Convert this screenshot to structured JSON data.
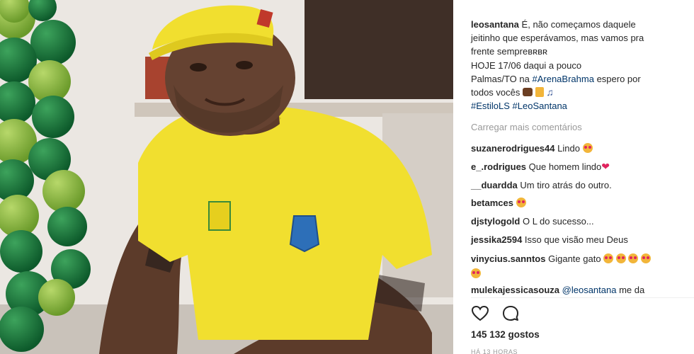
{
  "post": {
    "author": "leosantana",
    "caption_lines": [
      "É, não começamos daquele",
      "jeitinho que esperávamos, mas vamos pra",
      "frente sempreʙʀʙʀ",
      "HOJE 17/06 daqui a pouco"
    ],
    "caption_palmas": "Palmas/TO na",
    "caption_hashtag_arena": "#ArenaBrahma",
    "caption_espero": "espero por",
    "caption_todos": "todos vocês",
    "hashtag_estilo": "#EstiloLS",
    "hashtag_leo": "#LeoSantana",
    "load_more": "Carregar mais comentários",
    "likes": "145 132 gostos",
    "time": "HÁ 13 HORAS"
  },
  "comments": [
    {
      "user": "suzanerodrigues44",
      "text": "Lindo"
    },
    {
      "user": "e_.rodrigues",
      "text": "Que homem lindo"
    },
    {
      "user": "__duardda",
      "text": "Um tiro atrás do outro."
    },
    {
      "user": "betamces",
      "text": ""
    },
    {
      "user": "djstylogold",
      "text": "O L do sucesso..."
    },
    {
      "user": "jessika2594",
      "text": "Isso que visão meu Deus"
    },
    {
      "user": "vinycius.sanntos",
      "text": "Gigante gato"
    },
    {
      "user": "mulekajessicasouza",
      "text": "me da",
      "mention": "@leosantana"
    }
  ],
  "icons": {
    "like": "heart-outline-icon",
    "comment": "comment-bubble-icon"
  },
  "colors": {
    "shirt": "#f1df2f",
    "balloon_dark": "#1f7a3d",
    "balloon_light": "#8fc23f",
    "link": "#003569"
  }
}
